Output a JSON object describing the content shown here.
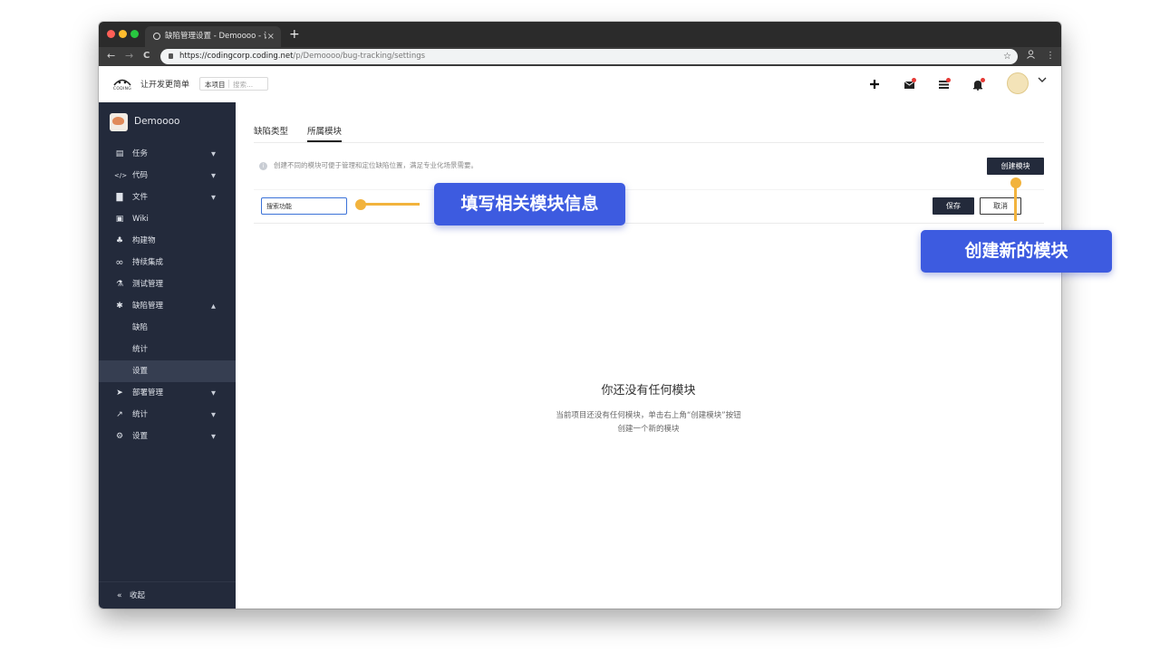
{
  "browser": {
    "tab_title": "缺陷管理设置 - Demoooo - 让开发更简单",
    "tab_close": "×",
    "new_tab": "+",
    "url_host": "https://codingcorp.coding.net",
    "url_path": "/p/Demoooo/bug-tracking/settings",
    "nav_back": "←",
    "nav_forward": "→",
    "nav_reload": "C",
    "star": "☆",
    "menu": "⋮"
  },
  "header": {
    "logo_text": "CODING",
    "slogan": "让开发更简单",
    "scope_label": "本项目",
    "search_placeholder": "搜索...",
    "icons": [
      "plus-icon",
      "mail-icon",
      "todo-icon",
      "bell-icon"
    ]
  },
  "sidebar": {
    "project_name": "Demoooo",
    "items": [
      {
        "label": "任务",
        "icon": "▤",
        "arrow": "▼"
      },
      {
        "label": "代码",
        "icon": "</>",
        "arrow": "▼"
      },
      {
        "label": "文件",
        "icon": "▇",
        "arrow": "▼"
      },
      {
        "label": "Wiki",
        "icon": "▣",
        "arrow": ""
      },
      {
        "label": "构建物",
        "icon": "♣",
        "arrow": ""
      },
      {
        "label": "持续集成",
        "icon": "∞",
        "arrow": ""
      },
      {
        "label": "测试管理",
        "icon": "⚗",
        "arrow": ""
      },
      {
        "label": "缺陷管理",
        "icon": "✱",
        "arrow": "▲"
      },
      {
        "label": "部署管理",
        "icon": "➤",
        "arrow": "▼"
      },
      {
        "label": "统计",
        "icon": "↗",
        "arrow": "▼"
      },
      {
        "label": "设置",
        "icon": "⚙",
        "arrow": "▼"
      }
    ],
    "sub_items": [
      {
        "label": "缺陷"
      },
      {
        "label": "统计"
      },
      {
        "label": "设置"
      }
    ],
    "collapse_icon": "«",
    "collapse_label": "收起"
  },
  "main": {
    "tabs": [
      {
        "label": "缺陷类型"
      },
      {
        "label": "所属模块"
      }
    ],
    "info_icon": "i",
    "info_text": "创建不同的模块可便于管理和定位缺陷位置，满足专业化场景需要。",
    "create_button": "创建模块",
    "input_value": "搜索功能",
    "save_button": "保存",
    "cancel_button": "取消",
    "empty_title": "你还没有任何模块",
    "empty_line1": "当前项目还没有任何模块，单击右上角“创建模块”按钮",
    "empty_line2": "创建一个新的模块"
  },
  "annotations": {
    "fill_info": "填写相关模块信息",
    "create_new": "创建新的模块"
  },
  "colors": {
    "sidebar_bg": "#232a3b",
    "callout": "#3d5be0",
    "accent_orange": "#f2b33d",
    "notification_red": "#e53935"
  }
}
